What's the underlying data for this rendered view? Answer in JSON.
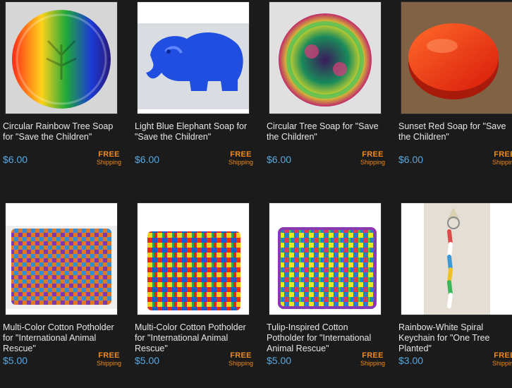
{
  "products": [
    {
      "title": "Circular Rainbow Tree Soap for \"Save the Children\"",
      "price": "$6.00",
      "free": "FREE",
      "shipping": "Shipping",
      "icon": "rainbow-tree-soap-image"
    },
    {
      "title": "Light Blue Elephant Soap for \"Save the Children\"",
      "price": "$6.00",
      "free": "FREE",
      "shipping": "Shipping",
      "icon": "elephant-soap-image"
    },
    {
      "title": "Circular Tree Soap for \"Save the Children\"",
      "price": "$6.00",
      "free": "FREE",
      "shipping": "Shipping",
      "icon": "tree-soap-image"
    },
    {
      "title": "Sunset Red Soap for \"Save the Children\"",
      "price": "$6.00",
      "free": "FREE",
      "shipping": "Shipping",
      "icon": "red-soap-image"
    },
    {
      "title": "Multi-Color Cotton Potholder for \"International Animal Rescue\"",
      "price": "$5.00",
      "free": "FREE",
      "shipping": "Shipping",
      "icon": "potholder-image"
    },
    {
      "title": "Multi-Color Cotton Potholder for \"International Animal Rescue\"",
      "price": "$5.00",
      "free": "FREE",
      "shipping": "Shipping",
      "icon": "potholder-image"
    },
    {
      "title": "Tulip-Inspired Cotton Potholder for \"International Animal Rescue\"",
      "price": "$5.00",
      "free": "FREE",
      "shipping": "Shipping",
      "icon": "potholder-image"
    },
    {
      "title": "Rainbow-White Spiral Keychain for \"One Tree Planted\"",
      "price": "$3.00",
      "free": "FREE",
      "shipping": "Shipping",
      "icon": "keychain-image"
    }
  ],
  "colors": {
    "background": "#1b1b1b",
    "title": "#e6e6e6",
    "price": "#58a9e0",
    "shipping": "#f08a1c"
  }
}
